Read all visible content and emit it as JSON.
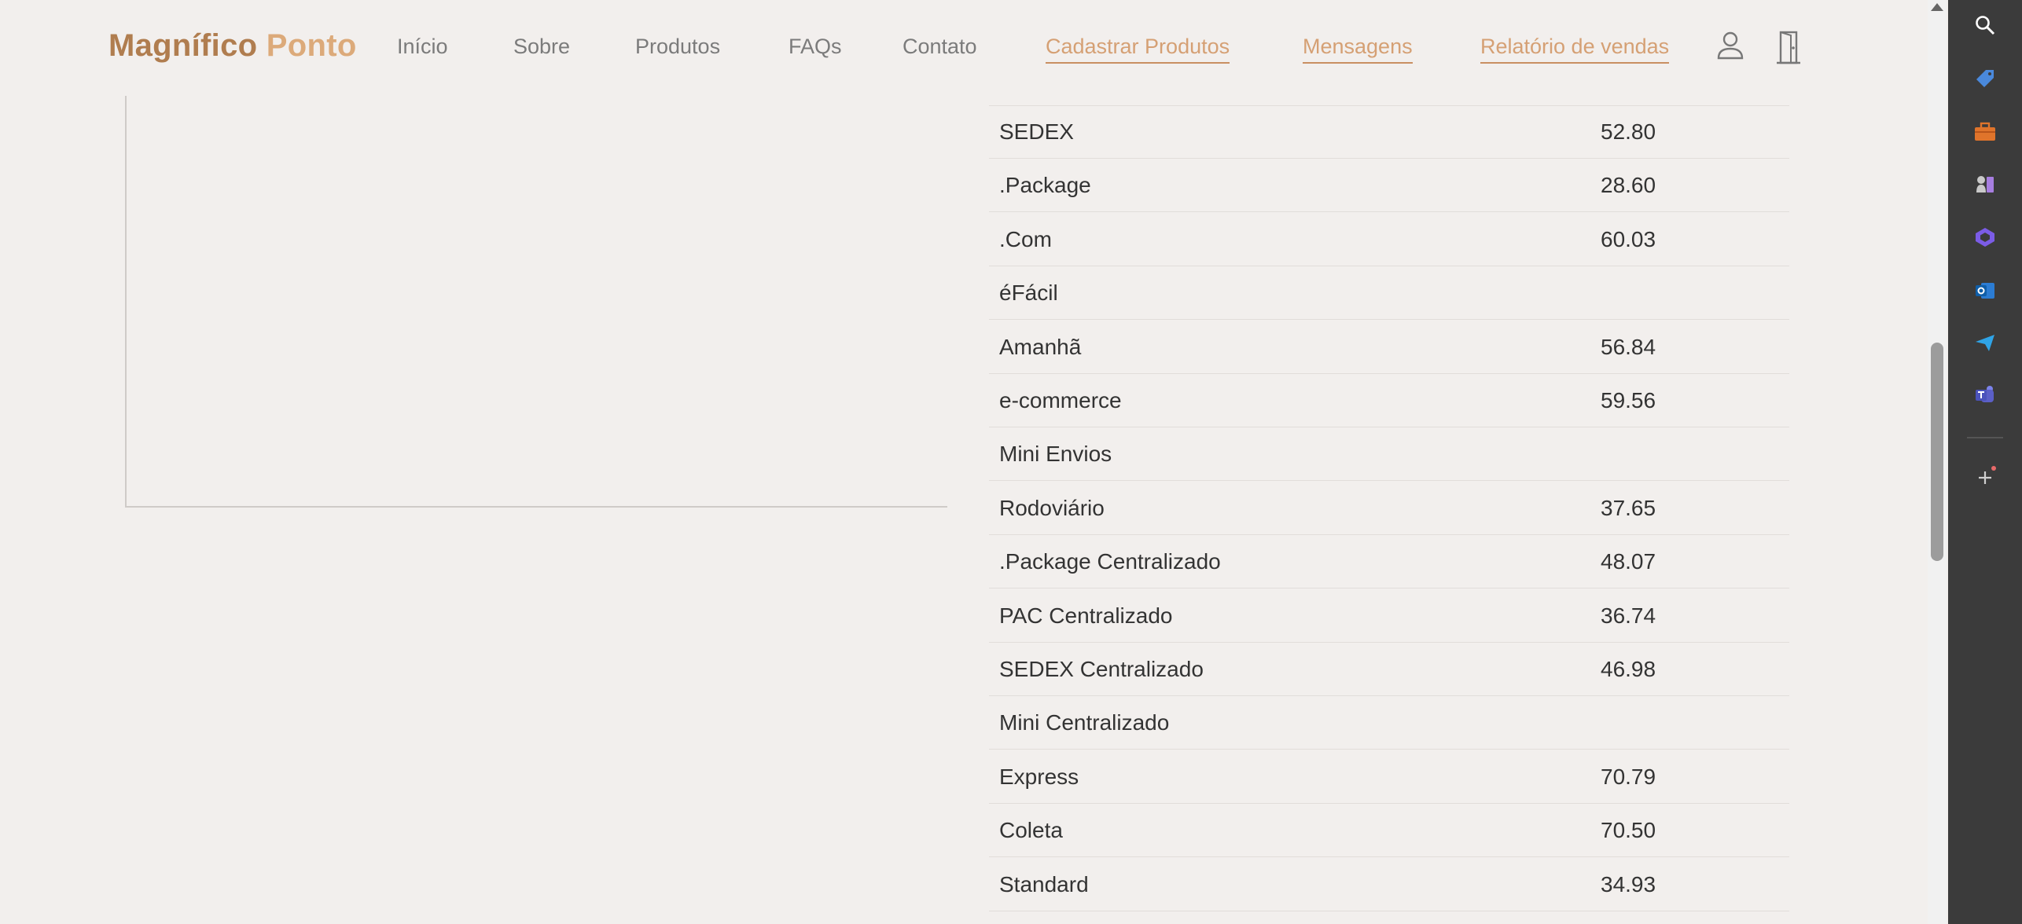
{
  "brand": {
    "part1": "Magnífico",
    "part2": "Ponto"
  },
  "nav": {
    "inicio": "Início",
    "sobre": "Sobre",
    "produtos": "Produtos",
    "faqs": "FAQs",
    "contato": "Contato",
    "cadastrar": "Cadastrar Produtos",
    "mensagens": "Mensagens",
    "relatorio": "Relatório de vendas"
  },
  "table": {
    "rows": [
      {
        "name": "SEDEX",
        "value": "52.80"
      },
      {
        "name": ".Package",
        "value": "28.60"
      },
      {
        "name": ".Com",
        "value": "60.03"
      },
      {
        "name": "éFácil",
        "value": ""
      },
      {
        "name": "Amanhã",
        "value": "56.84"
      },
      {
        "name": "e-commerce",
        "value": "59.56"
      },
      {
        "name": "Mini Envios",
        "value": ""
      },
      {
        "name": "Rodoviário",
        "value": "37.65"
      },
      {
        "name": ".Package Centralizado",
        "value": "48.07"
      },
      {
        "name": "PAC Centralizado",
        "value": "36.74"
      },
      {
        "name": "SEDEX Centralizado",
        "value": "46.98"
      },
      {
        "name": "Mini Centralizado",
        "value": ""
      },
      {
        "name": "Express",
        "value": "70.79"
      },
      {
        "name": "Coleta",
        "value": "70.50"
      },
      {
        "name": "Standard",
        "value": "34.93"
      }
    ]
  },
  "colors": {
    "brand_dark": "#b07d4f",
    "brand_light": "#dcaa7a",
    "accent_link": "#d5a074",
    "background": "#f2efed",
    "sidebar": "#3b3b3b"
  },
  "sidebar_icons": [
    "search-icon",
    "tag-icon",
    "briefcase-icon",
    "chess-icon",
    "copilot-icon",
    "outlook-icon",
    "send-icon",
    "teams-icon",
    "add-icon"
  ]
}
